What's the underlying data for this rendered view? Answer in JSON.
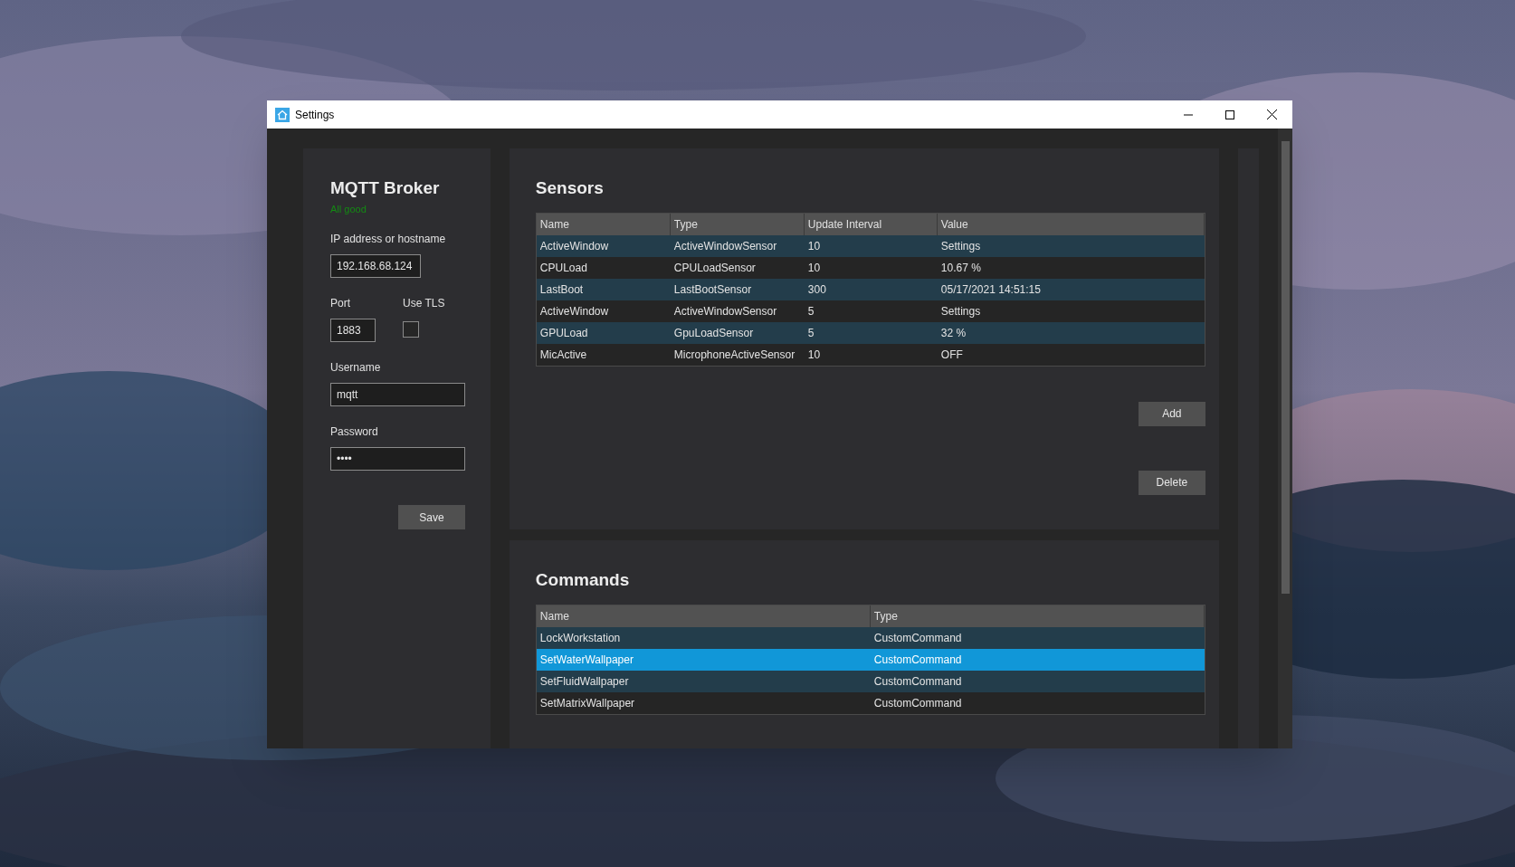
{
  "window": {
    "title": "Settings"
  },
  "broker": {
    "title": "MQTT Broker",
    "status": "All good",
    "ip_label": "IP address or hostname",
    "ip_value": "192.168.68.124",
    "port_label": "Port",
    "port_value": "1883",
    "tls_label": "Use TLS",
    "tls_checked": false,
    "username_label": "Username",
    "username_value": "mqtt",
    "password_label": "Password",
    "password_value": "••••",
    "save": "Save"
  },
  "sensors": {
    "title": "Sensors",
    "columns": [
      "Name",
      "Type",
      "Update Interval",
      "Value"
    ],
    "rows": [
      {
        "cells": [
          "ActiveWindow",
          "ActiveWindowSensor",
          "10",
          "Settings"
        ]
      },
      {
        "cells": [
          "CPULoad",
          "CPULoadSensor",
          "10",
          "10.67 %"
        ]
      },
      {
        "cells": [
          "LastBoot",
          "LastBootSensor",
          "300",
          "05/17/2021 14:51:15"
        ]
      },
      {
        "cells": [
          "ActiveWindow",
          "ActiveWindowSensor",
          "5",
          "Settings"
        ]
      },
      {
        "cells": [
          "GPULoad",
          "GpuLoadSensor",
          "5",
          "32 %"
        ]
      },
      {
        "cells": [
          "MicActive",
          "MicrophoneActiveSensor",
          "10",
          "OFF"
        ]
      }
    ],
    "buttons": [
      "Add",
      "Delete"
    ]
  },
  "commands": {
    "title": "Commands",
    "columns": [
      "Name",
      "Type"
    ],
    "rows": [
      {
        "cells": [
          "LockWorkstation",
          "CustomCommand"
        ],
        "selected": false
      },
      {
        "cells": [
          "SetWaterWallpaper",
          "CustomCommand"
        ],
        "selected": true
      },
      {
        "cells": [
          "SetFluidWallpaper",
          "CustomCommand"
        ],
        "selected": false
      },
      {
        "cells": [
          "SetMatrixWallpaper",
          "CustomCommand"
        ],
        "selected": false
      }
    ]
  }
}
